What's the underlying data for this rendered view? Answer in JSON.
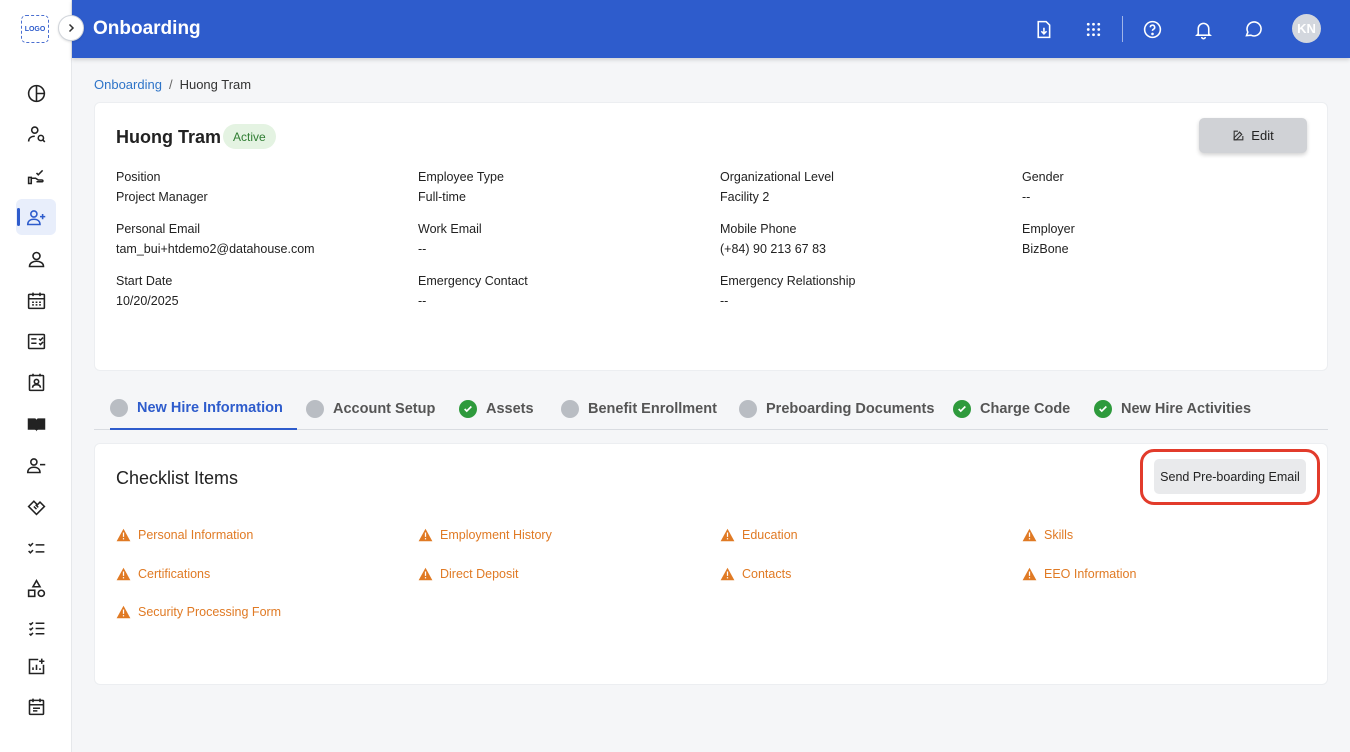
{
  "sidebar": {
    "logo_text": "LOGO",
    "items": [
      {
        "icon": "pie-chart-icon"
      },
      {
        "icon": "user-search-icon"
      },
      {
        "icon": "hand-check-icon"
      },
      {
        "icon": "user-add-icon",
        "active": true
      },
      {
        "icon": "person-icon"
      },
      {
        "icon": "calendar-grid-icon"
      },
      {
        "icon": "checklist-doc-icon"
      },
      {
        "icon": "contact-card-icon"
      },
      {
        "icon": "book-icon"
      },
      {
        "icon": "user-remove-icon"
      },
      {
        "icon": "handshake-icon"
      },
      {
        "icon": "task-list-icon"
      },
      {
        "icon": "shapes-icon"
      },
      {
        "icon": "numbered-list-icon"
      },
      {
        "icon": "report-add-icon"
      },
      {
        "icon": "event-note-icon"
      }
    ]
  },
  "header": {
    "title": "Onboarding",
    "avatar_initials": "KN",
    "icons": [
      "download-doc-icon",
      "apps-grid-icon",
      "help-icon",
      "bell-icon",
      "chat-icon"
    ],
    "brand_color": "#2E5CCC"
  },
  "breadcrumb": {
    "parent": "Onboarding",
    "separator": "/",
    "current": "Huong Tram"
  },
  "profile": {
    "name": "Huong Tram",
    "status": "Active",
    "edit_label": "Edit",
    "fields": {
      "position": {
        "label": "Position",
        "value": "Project Manager"
      },
      "employee_type": {
        "label": "Employee Type",
        "value": "Full-time"
      },
      "org_level": {
        "label": "Organizational Level",
        "value": "Facility 2"
      },
      "gender": {
        "label": "Gender",
        "value": "--"
      },
      "personal_email": {
        "label": "Personal Email",
        "value": "tam_bui+htdemo2@datahouse.com"
      },
      "work_email": {
        "label": "Work Email",
        "value": "--"
      },
      "mobile_phone": {
        "label": "Mobile Phone",
        "value": "(+84) 90 213 67 83"
      },
      "employer": {
        "label": "Employer",
        "value": "BizBone"
      },
      "start_date": {
        "label": "Start Date",
        "value": "10/20/2025"
      },
      "emergency_contact": {
        "label": "Emergency Contact",
        "value": "--"
      },
      "emergency_relationship": {
        "label": "Emergency Relationship",
        "value": "--"
      }
    }
  },
  "tabs": [
    {
      "label": "New Hire Information",
      "status": "pending",
      "active": true
    },
    {
      "label": "Account Setup",
      "status": "pending"
    },
    {
      "label": "Assets",
      "status": "complete"
    },
    {
      "label": "Benefit Enrollment",
      "status": "pending"
    },
    {
      "label": "Preboarding Documents",
      "status": "pending"
    },
    {
      "label": "Charge Code",
      "status": "complete"
    },
    {
      "label": "New Hire Activities",
      "status": "complete"
    }
  ],
  "checklist": {
    "title": "Checklist Items",
    "send_button": "Send Pre-boarding Email",
    "warning_color": "#E07A24",
    "items": [
      "Personal Information",
      "Employment History",
      "Education",
      "Skills",
      "Certifications",
      "Direct Deposit",
      "Contacts",
      "EEO Information",
      "Security Processing Form"
    ]
  }
}
